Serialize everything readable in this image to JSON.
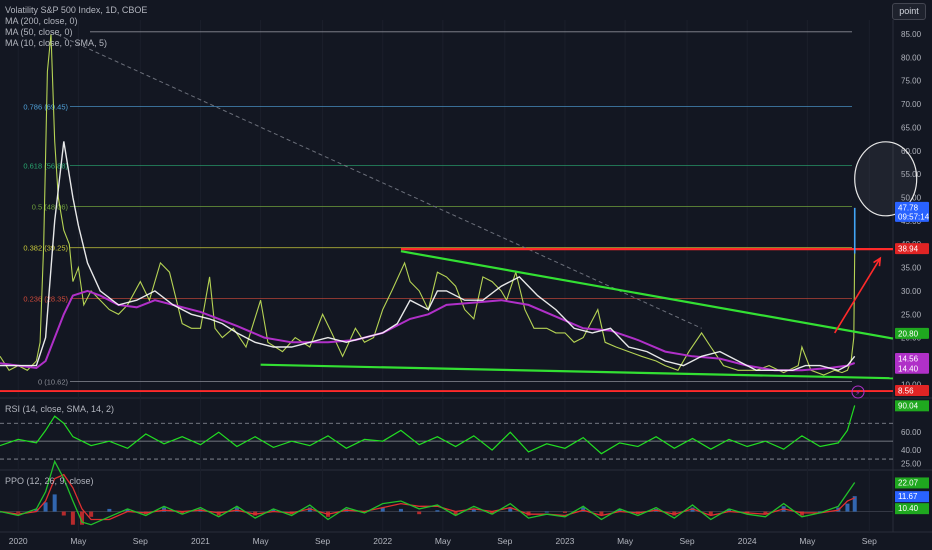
{
  "legends": {
    "main_title": "Volatility S&P 500 Index, 1D, CBOE",
    "ma200": "MA (200, close, 0)",
    "ma50": "MA (50, close, 0)",
    "ma10": "MA (10, close, 0, SMA, 5)",
    "rsi": "RSI (14, close, SMA, 14, 2)",
    "ppo": "PPO (12, 26, 9, close)"
  },
  "toolbar": {
    "point_label": "point"
  },
  "colors": {
    "background": "#131722",
    "price": "#c8e85a",
    "ma10": "#ffffff",
    "ma50": "#b030c8",
    "ma200": "#2962ff",
    "resistance": "#ff2a2a",
    "trendline": "#33e033",
    "rsi": "#22dd22",
    "ppo_line": "#22c02a",
    "ppo_signal": "#e03030",
    "hist_up": "#3a7bd5",
    "hist_down": "#e03030"
  },
  "icons": {
    "flash": "lightning-icon"
  },
  "chart_data": {
    "type": "line",
    "title": "Volatility S&P 500 Index, 1D, CBOE",
    "price_panel": {
      "ylim": [
        7.5,
        88
      ],
      "y_ticks": [
        "85.00",
        "80.00",
        "75.00",
        "70.00",
        "65.00",
        "60.00",
        "55.00",
        "50.00",
        "45.00",
        "40.00",
        "35.00",
        "30.00",
        "25.00",
        "20.00",
        "15.00",
        "10.00"
      ],
      "y_tick_values": [
        85,
        80,
        75,
        70,
        65,
        60,
        55,
        50,
        45,
        40,
        35,
        30,
        25,
        20,
        15,
        10
      ],
      "x_tick_labels": [
        "2020",
        "May",
        "Sep",
        "2021",
        "May",
        "Sep",
        "2022",
        "May",
        "Sep",
        "2023",
        "May",
        "Sep",
        "2024",
        "May",
        "Sep"
      ],
      "x_tick_times": [
        2020.0,
        2020.33,
        2020.67,
        2021.0,
        2021.33,
        2021.67,
        2022.0,
        2022.33,
        2022.67,
        2023.0,
        2023.33,
        2023.67,
        2024.0,
        2024.33,
        2024.67
      ],
      "xlim": [
        2019.9,
        2024.8
      ],
      "series": [
        {
          "name": "MA (10, close, 0, SMA, 5)",
          "t": [
            2019.9,
            2020.1,
            2020.15,
            2020.2,
            2020.25,
            2020.3,
            2020.33,
            2020.38,
            2020.45,
            2020.55,
            2020.65,
            2020.75,
            2020.85,
            2020.95,
            2021.05,
            2021.12,
            2021.2,
            2021.3,
            2021.4,
            2021.5,
            2021.6,
            2021.7,
            2021.8,
            2021.9,
            2022.0,
            2022.08,
            2022.15,
            2022.25,
            2022.3,
            2022.35,
            2022.45,
            2022.55,
            2022.65,
            2022.75,
            2022.85,
            2022.95,
            2023.05,
            2023.15,
            2023.25,
            2023.35,
            2023.45,
            2023.55,
            2023.65,
            2023.75,
            2023.85,
            2023.95,
            2024.05,
            2024.15,
            2024.25,
            2024.32,
            2024.4,
            2024.5,
            2024.55,
            2024.59
          ],
          "values": [
            14,
            14,
            20,
            45,
            62,
            50,
            44,
            36,
            30,
            27,
            28,
            30,
            27,
            25,
            24,
            23,
            21,
            19,
            18,
            18,
            19,
            20,
            19,
            20,
            21,
            23,
            28,
            26,
            30,
            30,
            28,
            28,
            31,
            33,
            29,
            26,
            22,
            21,
            22,
            18,
            17,
            15,
            14,
            16,
            17,
            15,
            13,
            13,
            13,
            14,
            14,
            13,
            14,
            16
          ]
        },
        {
          "name": "MA (50, close, 0)",
          "t": [
            2019.9,
            2020.1,
            2020.15,
            2020.25,
            2020.3,
            2020.38,
            2020.45,
            2020.55,
            2020.65,
            2020.75,
            2020.85,
            2021.0,
            2021.1,
            2021.2,
            2021.35,
            2021.5,
            2021.7,
            2021.85,
            2022.0,
            2022.15,
            2022.25,
            2022.35,
            2022.5,
            2022.65,
            2022.8,
            2022.95,
            2023.1,
            2023.25,
            2023.4,
            2023.55,
            2023.7,
            2023.85,
            2024.0,
            2024.15,
            2024.3,
            2024.45,
            2024.55,
            2024.59
          ],
          "values": [
            14.5,
            13.5,
            15,
            25,
            29,
            30,
            29,
            27,
            26.5,
            28,
            27,
            25.5,
            24,
            22.5,
            20,
            19,
            19,
            19.5,
            21,
            24,
            25,
            27,
            27.5,
            28,
            27,
            24.5,
            22,
            21.5,
            19.5,
            17,
            16,
            15.5,
            14,
            13,
            13,
            13.5,
            14,
            14.56
          ]
        },
        {
          "name": "Price",
          "t": [
            2019.9,
            2019.95,
            2020.0,
            2020.05,
            2020.1,
            2020.12,
            2020.14,
            2020.16,
            2020.18,
            2020.2,
            2020.22,
            2020.25,
            2020.28,
            2020.3,
            2020.33,
            2020.36,
            2020.4,
            2020.45,
            2020.5,
            2020.55,
            2020.6,
            2020.67,
            2020.72,
            2020.78,
            2020.83,
            2020.9,
            2020.95,
            2021.0,
            2021.05,
            2021.08,
            2021.12,
            2021.18,
            2021.25,
            2021.33,
            2021.37,
            2021.45,
            2021.52,
            2021.6,
            2021.67,
            2021.72,
            2021.78,
            2021.85,
            2021.9,
            2021.95,
            2022.0,
            2022.05,
            2022.12,
            2022.15,
            2022.2,
            2022.25,
            2022.3,
            2022.35,
            2022.4,
            2022.45,
            2022.5,
            2022.55,
            2022.6,
            2022.65,
            2022.68,
            2022.73,
            2022.78,
            2022.83,
            2022.9,
            2022.95,
            2023.0,
            2023.05,
            2023.1,
            2023.18,
            2023.22,
            2023.28,
            2023.35,
            2023.42,
            2023.5,
            2023.55,
            2023.62,
            2023.68,
            2023.75,
            2023.8,
            2023.87,
            2023.95,
            2024.0,
            2024.05,
            2024.12,
            2024.2,
            2024.28,
            2024.3,
            2024.35,
            2024.42,
            2024.48,
            2024.52,
            2024.55,
            2024.57,
            2024.585,
            2024.59
          ],
          "values": [
            16,
            13,
            14,
            13,
            15,
            19,
            40,
            77,
            85,
            62,
            50,
            43,
            40,
            32,
            35,
            27,
            30,
            28,
            26,
            25,
            27,
            32,
            28,
            36,
            34,
            23,
            22,
            22,
            33,
            22,
            20,
            22,
            18,
            28,
            19,
            17,
            20,
            18,
            25,
            21,
            16,
            22,
            19,
            20,
            26,
            30,
            36,
            32,
            30,
            26,
            34,
            33,
            31,
            26,
            24,
            33,
            32,
            30,
            28,
            34,
            26,
            22,
            22,
            21,
            21,
            19,
            20,
            26,
            19,
            18,
            17,
            16,
            15,
            14,
            13,
            17,
            21,
            18,
            14,
            13,
            13,
            13,
            14,
            12.5,
            14,
            18,
            13,
            12,
            13,
            12.5,
            13,
            15,
            20,
            38
          ]
        }
      ],
      "fib_levels": [
        {
          "label": "0.786 (69.45)",
          "value": 69.45
        },
        {
          "label": "0.618 (56.88)",
          "value": 56.88
        },
        {
          "label": "0.5 (48.06)",
          "value": 48.06
        },
        {
          "label": "0.382 (39.25)",
          "value": 39.25
        },
        {
          "label": "0.236 (28.35)",
          "value": 28.35
        },
        {
          "label": "0 (10.62)",
          "value": 10.62
        }
      ],
      "levels": [
        85.47,
        38.94,
        8.56
      ],
      "price_labels": [
        {
          "text": "47.78",
          "sub": "09:57:14",
          "value": 47.78
        },
        {
          "text": "38.94",
          "value": 38.94
        },
        {
          "text": "20.80",
          "value": 20.8
        },
        {
          "text": "14.56",
          "value": 14.56
        },
        {
          "text": "14.40",
          "value": 14.4
        },
        {
          "text": "8.56",
          "value": 8.56
        }
      ],
      "trendlines": [
        {
          "name": "descending",
          "t": [
            2022.1,
            2024.8
          ],
          "values": [
            38.5,
            19.8
          ]
        },
        {
          "name": "support",
          "t": [
            2021.33,
            2024.8
          ],
          "values": [
            14.2,
            11.3
          ]
        },
        {
          "name": "diagonal",
          "t": [
            2020.18,
            2023.75
          ],
          "values": [
            85.5,
            22.0
          ]
        }
      ],
      "arrow": {
        "t": [
          2024.48,
          2024.73
        ],
        "values": [
          21,
          37
        ]
      },
      "circle": {
        "t": 2024.76,
        "value": 54
      }
    },
    "rsi_panel": {
      "y_ticks": [
        "90.04",
        "60.00",
        "40.00",
        "25.00"
      ],
      "y_tick_values": [
        90.04,
        60,
        40,
        25
      ],
      "ylim": [
        20,
        96
      ],
      "bands": [
        70,
        50,
        30
      ],
      "last": 90.04,
      "t": [
        2019.9,
        2020.0,
        2020.1,
        2020.15,
        2020.2,
        2020.25,
        2020.3,
        2020.4,
        2020.5,
        2020.6,
        2020.7,
        2020.8,
        2020.9,
        2021.0,
        2021.1,
        2021.2,
        2021.3,
        2021.4,
        2021.5,
        2021.6,
        2021.7,
        2021.8,
        2021.9,
        2022.0,
        2022.1,
        2022.2,
        2022.3,
        2022.4,
        2022.5,
        2022.6,
        2022.7,
        2022.8,
        2022.9,
        2023.0,
        2023.1,
        2023.2,
        2023.3,
        2023.4,
        2023.5,
        2023.6,
        2023.7,
        2023.8,
        2023.9,
        2024.0,
        2024.1,
        2024.2,
        2024.3,
        2024.4,
        2024.5,
        2024.55,
        2024.59
      ],
      "values": [
        45,
        52,
        48,
        62,
        78,
        70,
        55,
        45,
        50,
        42,
        58,
        47,
        55,
        46,
        60,
        44,
        55,
        43,
        50,
        45,
        56,
        42,
        52,
        50,
        62,
        46,
        55,
        44,
        56,
        40,
        60,
        38,
        47,
        42,
        54,
        36,
        48,
        44,
        55,
        42,
        53,
        41,
        52,
        44,
        50,
        41,
        56,
        44,
        48,
        62,
        90
      ]
    },
    "ppo_panel": {
      "y_ticks": [
        "22.07",
        "11.67",
        "10.40"
      ],
      "y_tick_values": [
        22.07,
        11.67,
        10.4
      ],
      "ylim": [
        -14,
        30
      ],
      "t": [
        2019.9,
        2020.0,
        2020.1,
        2020.15,
        2020.2,
        2020.25,
        2020.3,
        2020.35,
        2020.4,
        2020.5,
        2020.6,
        2020.7,
        2020.8,
        2020.9,
        2021.0,
        2021.1,
        2021.2,
        2021.3,
        2021.4,
        2021.5,
        2021.6,
        2021.7,
        2021.8,
        2021.9,
        2022.0,
        2022.1,
        2022.2,
        2022.3,
        2022.4,
        2022.5,
        2022.6,
        2022.7,
        2022.8,
        2022.9,
        2023.0,
        2023.1,
        2023.2,
        2023.3,
        2023.4,
        2023.5,
        2023.6,
        2023.7,
        2023.8,
        2023.9,
        2024.0,
        2024.1,
        2024.2,
        2024.3,
        2024.4,
        2024.5,
        2024.55,
        2024.59
      ],
      "ppo": [
        0,
        -3,
        2,
        15,
        38,
        25,
        8,
        -8,
        -10,
        -4,
        2,
        -3,
        4,
        -2,
        3,
        -4,
        4,
        -5,
        2,
        -3,
        5,
        -6,
        3,
        -1,
        6,
        8,
        2,
        5,
        -3,
        4,
        -2,
        6,
        -5,
        -2,
        -4,
        4,
        -6,
        2,
        -3,
        3,
        -5,
        5,
        -6,
        2,
        -2,
        -4,
        6,
        -4,
        -1,
        4,
        14,
        22.07
      ],
      "signal": [
        0,
        -2,
        0,
        8,
        25,
        28,
        18,
        2,
        -6,
        -6,
        0,
        -1,
        1,
        0,
        1,
        -1,
        1,
        -2,
        0,
        -1,
        2,
        -2,
        1,
        0,
        3,
        6,
        4,
        4,
        0,
        2,
        0,
        3,
        -2,
        -2,
        -3,
        1,
        -3,
        0,
        -1,
        1,
        -2,
        2,
        -3,
        0,
        -1,
        -2,
        2,
        -1,
        -1,
        1,
        8,
        10.4
      ]
    }
  }
}
